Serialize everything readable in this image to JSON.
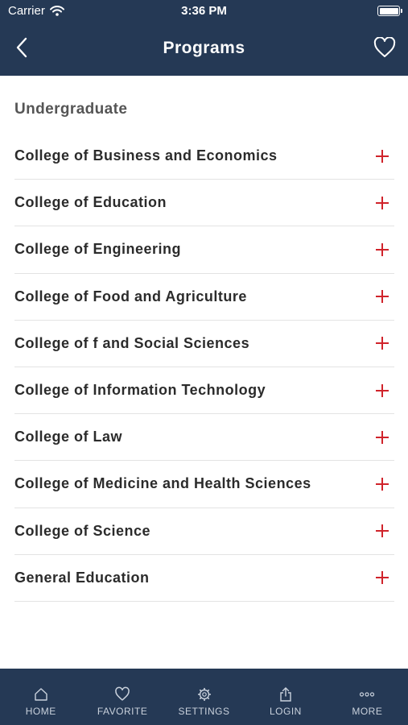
{
  "colors": {
    "header_bg": "#253955",
    "accent_plus": "#d0232b",
    "tab_bar_bg": "#253955"
  },
  "status_bar": {
    "carrier": "Carrier",
    "time": "3:36 PM"
  },
  "nav": {
    "title": "Programs",
    "back_icon": "chevron-left-icon",
    "favorite_icon": "heart-icon"
  },
  "section": {
    "title": "Undergraduate"
  },
  "colleges": [
    {
      "label": "College of Business and Economics"
    },
    {
      "label": "College of Education"
    },
    {
      "label": "College of Engineering"
    },
    {
      "label": "College of Food and Agriculture"
    },
    {
      "label": "College of f and Social Sciences"
    },
    {
      "label": "College of Information Technology"
    },
    {
      "label": "College of Law"
    },
    {
      "label": "College of Medicine and Health Sciences"
    },
    {
      "label": "College of Science"
    },
    {
      "label": "General Education"
    }
  ],
  "tabs": [
    {
      "label": "HOME",
      "icon": "home-icon"
    },
    {
      "label": "FAVORITE",
      "icon": "heart-icon"
    },
    {
      "label": "SETTINGS",
      "icon": "gear-icon"
    },
    {
      "label": "LOGIN",
      "icon": "share-icon"
    },
    {
      "label": "MORE",
      "icon": "more-icon"
    }
  ]
}
